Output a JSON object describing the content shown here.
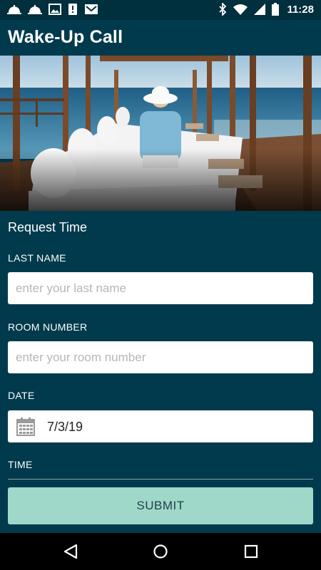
{
  "status_bar": {
    "time": "11:28",
    "left_icons": [
      "bell-icon",
      "bell-icon",
      "image-icon",
      "notification-icon",
      "mail-icon"
    ],
    "right_icons": [
      "bluetooth-icon",
      "wifi-icon",
      "signal-icon",
      "battery-icon"
    ]
  },
  "app_bar": {
    "title": "Wake-Up Call"
  },
  "hero": {
    "image": "hotel-beach-terrace-photo"
  },
  "form": {
    "section_title": "Request Time",
    "last_name": {
      "label": "LAST NAME",
      "placeholder": "enter your last name",
      "value": ""
    },
    "room_number": {
      "label": "ROOM NUMBER",
      "placeholder": "enter your room number",
      "value": ""
    },
    "date": {
      "label": "DATE",
      "value": "7/3/19",
      "icon": "calendar-icon"
    },
    "time": {
      "label": "TIME",
      "value": ""
    },
    "submit_label": "SUBMIT"
  },
  "nav_bar": {
    "buttons": [
      "back-icon",
      "home-icon",
      "recents-icon"
    ]
  },
  "colors": {
    "primary": "#003a4c",
    "accent": "#9fd8c9"
  }
}
